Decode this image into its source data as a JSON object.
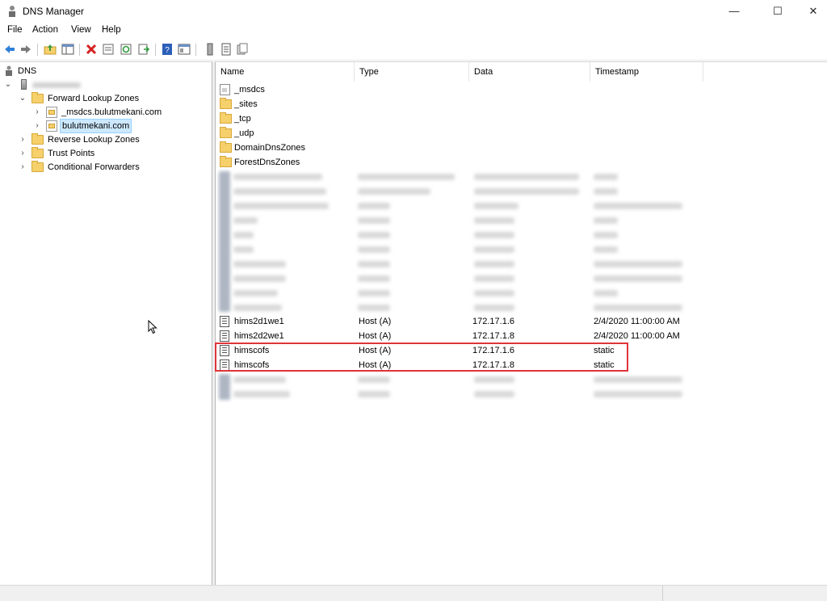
{
  "window": {
    "title": "DNS Manager"
  },
  "menu": [
    "File",
    "Action",
    "View",
    "Help"
  ],
  "tree": {
    "root": "DNS",
    "server": "",
    "forward_zones": "Forward Lookup Zones",
    "zone_msdcs": "_msdcs.bulutmekani.com",
    "zone_main": "bulutmekani.com",
    "reverse_zones": "Reverse Lookup Zones",
    "trust_points": "Trust Points",
    "conditional_forwarders": "Conditional Forwarders"
  },
  "columns": {
    "name": "Name",
    "type": "Type",
    "data": "Data",
    "timestamp": "Timestamp"
  },
  "folders": [
    "_msdcs",
    "_sites",
    "_tcp",
    "_udp",
    "DomainDnsZones",
    "ForestDnsZones"
  ],
  "records": [
    {
      "name": "hims2d1we1",
      "type": "Host (A)",
      "data": "172.17.1.6",
      "timestamp": "2/4/2020 11:00:00 AM"
    },
    {
      "name": "hims2d2we1",
      "type": "Host (A)",
      "data": "172.17.1.8",
      "timestamp": "2/4/2020 11:00:00 AM"
    },
    {
      "name": "himscofs",
      "type": "Host (A)",
      "data": "172.17.1.6",
      "timestamp": "static"
    },
    {
      "name": "himscofs",
      "type": "Host (A)",
      "data": "172.17.1.8",
      "timestamp": "static"
    }
  ],
  "colors": {
    "highlight": "#e0343a",
    "selection": "#cce8ff",
    "folder": "#f5d06b"
  },
  "icons": {
    "toolbar": [
      "back-icon",
      "forward-icon",
      "up-folder-icon",
      "show-hide-tree-icon",
      "delete-icon",
      "properties-icon",
      "refresh-icon",
      "export-icon",
      "help-icon",
      "console-icon",
      "server-icon",
      "list-icon",
      "copy-icon"
    ]
  }
}
